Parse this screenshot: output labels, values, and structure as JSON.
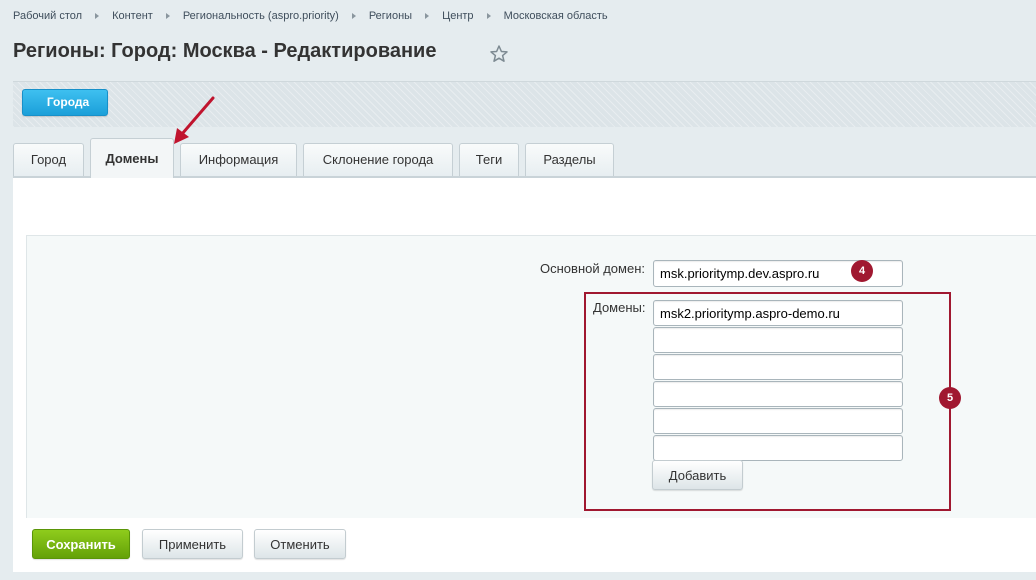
{
  "breadcrumb": [
    "Рабочий стол",
    "Контент",
    "Региональность (aspro.priority)",
    "Регионы",
    "Центр",
    "Московская область"
  ],
  "page": {
    "title": "Регионы: Город: Москва - Редактирование"
  },
  "context": {
    "back_button": "Города"
  },
  "tabs": [
    {
      "label": "Город",
      "active": false
    },
    {
      "label": "Домены",
      "active": true
    },
    {
      "label": "Информация",
      "active": false
    },
    {
      "label": "Склонение города",
      "active": false
    },
    {
      "label": "Теги",
      "active": false
    },
    {
      "label": "Разделы",
      "active": false
    }
  ],
  "form": {
    "main_domain_label": "Основной домен:",
    "main_domain_value": "msk.prioritymp.dev.aspro.ru",
    "domains_label": "Домены:",
    "domains": [
      "msk2.prioritymp.aspro-demo.ru",
      "",
      "",
      "",
      "",
      ""
    ],
    "add_button": "Добавить"
  },
  "annotations": {
    "badge_main": "4",
    "badge_domains": "5"
  },
  "actions": {
    "save": "Сохранить",
    "apply": "Применить",
    "cancel": "Отменить"
  },
  "colors": {
    "accent_blue": "#1b9fd9",
    "save_green": "#6fb00f",
    "annotation_red": "#a01830"
  },
  "icons": {
    "favorite": "star-icon",
    "pointer": "arrow-icon"
  }
}
